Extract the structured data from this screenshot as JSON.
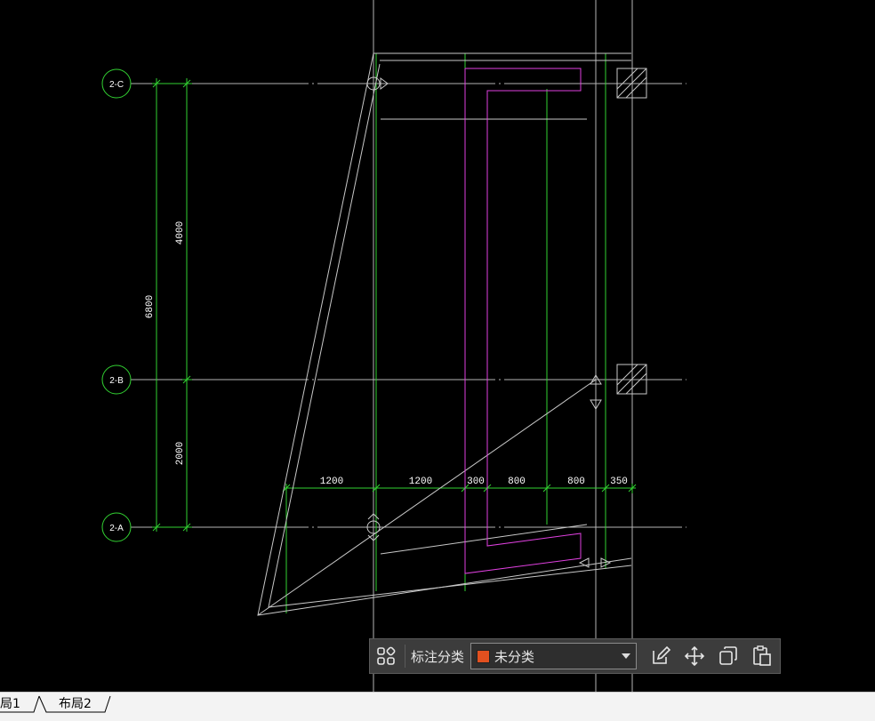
{
  "drawing": {
    "axes": [
      {
        "id": "c",
        "label": "2-C"
      },
      {
        "id": "b",
        "label": "2-B"
      },
      {
        "id": "a",
        "label": "2-A"
      }
    ],
    "vertical_dimensions": {
      "total": "6800",
      "upper": "4000",
      "lower": "2000"
    },
    "horizontal_dimensions": [
      "1200",
      "1200",
      "300",
      "800",
      "800",
      "350"
    ],
    "colors": {
      "background": "#000000",
      "dimension_line": "#32d232",
      "outline": "#c8c8c8",
      "magenta": "#e040e0",
      "axis_circle": "#32d232"
    }
  },
  "toolbar": {
    "label": "标注分类",
    "category_value": "未分类",
    "swatch_color": "#e2501f",
    "icons": [
      "group-icon",
      "edit-icon",
      "move-icon",
      "copy-icon",
      "paste-icon"
    ]
  },
  "tabs": [
    {
      "label": "局1"
    },
    {
      "label": "布局2"
    }
  ]
}
